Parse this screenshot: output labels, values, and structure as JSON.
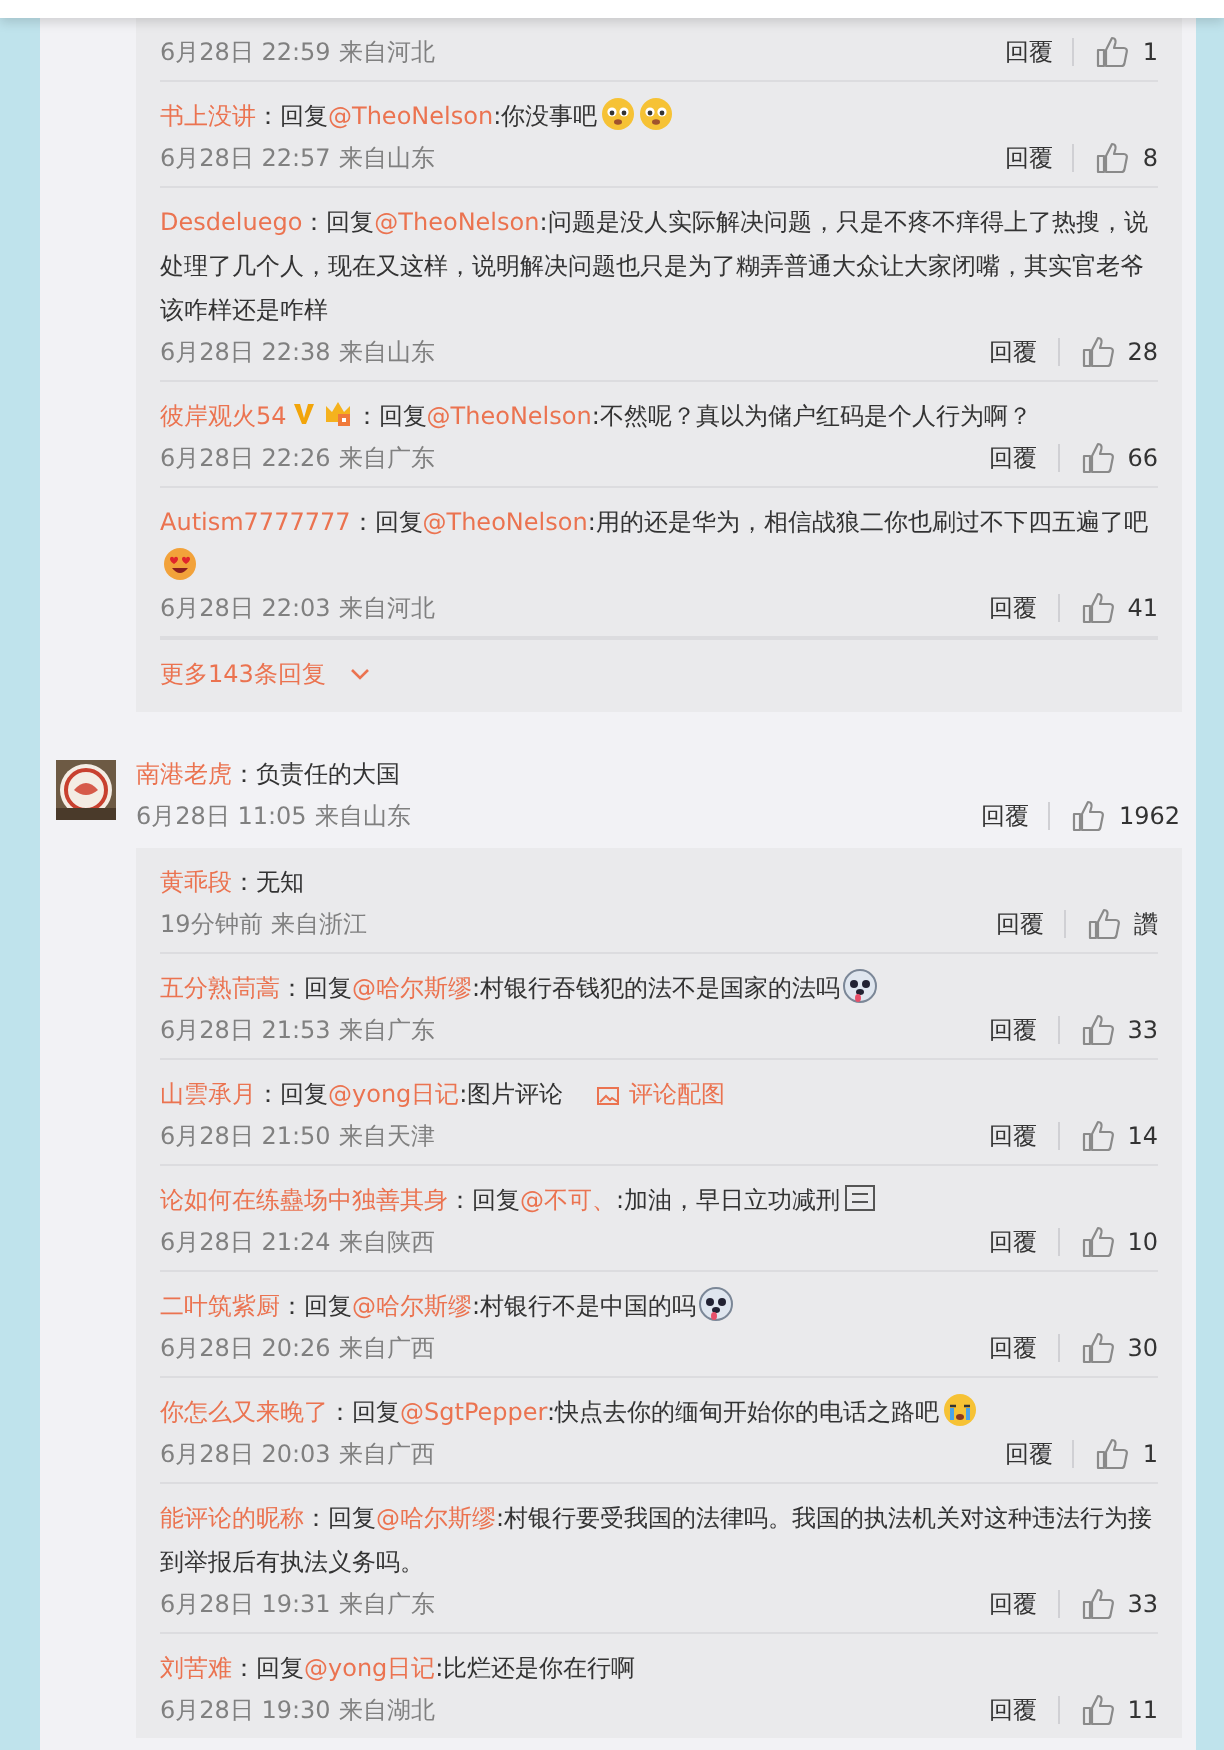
{
  "threads": [
    {
      "replies": [
        {
          "time": "6月28日 22:59",
          "location": "来自河北",
          "reply_label": "回覆",
          "likes": "1"
        },
        {
          "name": "书上没讲",
          "prefix": "：回复",
          "mention": "@TheoNelson",
          "text": ":你没事吧",
          "emoji": [
            {
              "kind": "face"
            },
            {
              "kind": "face"
            }
          ],
          "time": "6月28日 22:57",
          "location": "来自山东",
          "reply_label": "回覆",
          "likes": "8"
        },
        {
          "name": "Desdeluego",
          "prefix": "：回复",
          "mention": "@TheoNelson",
          "text": ":问题是没人实际解决问题，只是不疼不痒得上了热搜，说处理了几个人，现在又这样，说明解决问题也只是为了糊弄普通大众让大家闭嘴，其实官老爷该咋样还是咋样",
          "time": "6月28日 22:38",
          "location": "来自山东",
          "reply_label": "回覆",
          "likes": "28"
        },
        {
          "name": "彼岸观火54",
          "badges": [
            {
              "kind": "verified"
            },
            {
              "kind": "fan"
            }
          ],
          "prefix": "：回复",
          "mention": "@TheoNelson",
          "text": ":不然呢？真以为储户红码是个人行为啊？",
          "time": "6月28日 22:26",
          "location": "来自广东",
          "reply_label": "回覆",
          "likes": "66"
        },
        {
          "name": "Autism7777777",
          "prefix": "：回复",
          "mention": "@TheoNelson",
          "text": ":用的还是华为，相信战狼二你也刷过不下四五遍了吧",
          "emoji": [
            {
              "kind": "heart-eyes"
            }
          ],
          "time": "6月28日 22:03",
          "location": "来自河北",
          "reply_label": "回覆",
          "likes": "41"
        }
      ],
      "more": "更多143条回复"
    },
    {
      "comment": {
        "name": "南港老虎",
        "text": "：负责任的大国",
        "time": "6月28日 11:05",
        "location": "来自山东",
        "reply_label": "回覆",
        "likes": "1962"
      },
      "replies": [
        {
          "name": "黄乖段",
          "prefix": "：",
          "text": "无知",
          "time": "19分钟前",
          "location": "来自浙江",
          "reply_label": "回覆",
          "likes": "讚"
        },
        {
          "name": "五分熟茼蒿",
          "prefix": "：回复",
          "mention": "@哈尔斯缪",
          "text": ":村银行吞钱犯的法不是国家的法吗",
          "emoji": [
            {
              "kind": "dog"
            }
          ],
          "time": "6月28日 21:53",
          "location": "来自广东",
          "reply_label": "回覆",
          "likes": "33"
        },
        {
          "name": "山雲承月",
          "prefix": "：回复",
          "mention": "@yong日记",
          "text": ":图片评论",
          "attachment": "评论配图",
          "time": "6月28日 21:50",
          "location": "来自天津",
          "reply_label": "回覆",
          "likes": "14"
        },
        {
          "name": "论如何在练蠱场中独善其身",
          "prefix": "：回复",
          "mention": "@不可、",
          "text": ":加油，早日立功减刑",
          "emoji": [
            {
              "kind": "missing-glyph"
            }
          ],
          "time": "6月28日 21:24",
          "location": "来自陕西",
          "reply_label": "回覆",
          "likes": "10"
        },
        {
          "name": "二叶筑紫厨",
          "prefix": "：回复",
          "mention": "@哈尔斯缪",
          "text": ":村银行不是中国的吗",
          "emoji": [
            {
              "kind": "dog"
            }
          ],
          "time": "6月28日 20:26",
          "location": "来自广西",
          "reply_label": "回覆",
          "likes": "30"
        },
        {
          "name": "你怎么又来晚了",
          "prefix": "：回复",
          "mention": "@SgtPepper",
          "text": ":快点去你的缅甸开始你的电话之路吧",
          "emoji": [
            {
              "kind": "crying"
            }
          ],
          "time": "6月28日 20:03",
          "location": "来自广西",
          "reply_label": "回覆",
          "likes": "1"
        },
        {
          "name": "能评论的昵称",
          "prefix": "：回复",
          "mention": "@哈尔斯缪",
          "text": ":村银行要受我国的法律吗。我国的执法机关对这种违法行为接到举报后有执法义务吗。",
          "time": "6月28日 19:31",
          "location": "来自广东",
          "reply_label": "回覆",
          "likes": "33"
        },
        {
          "name": "刘苦难",
          "prefix": "：回复",
          "mention": "@yong日记",
          "text": ":比烂还是你在行啊",
          "time": "6月28日 19:30",
          "location": "来自湖北",
          "reply_label": "回覆",
          "likes": "11"
        }
      ]
    }
  ]
}
